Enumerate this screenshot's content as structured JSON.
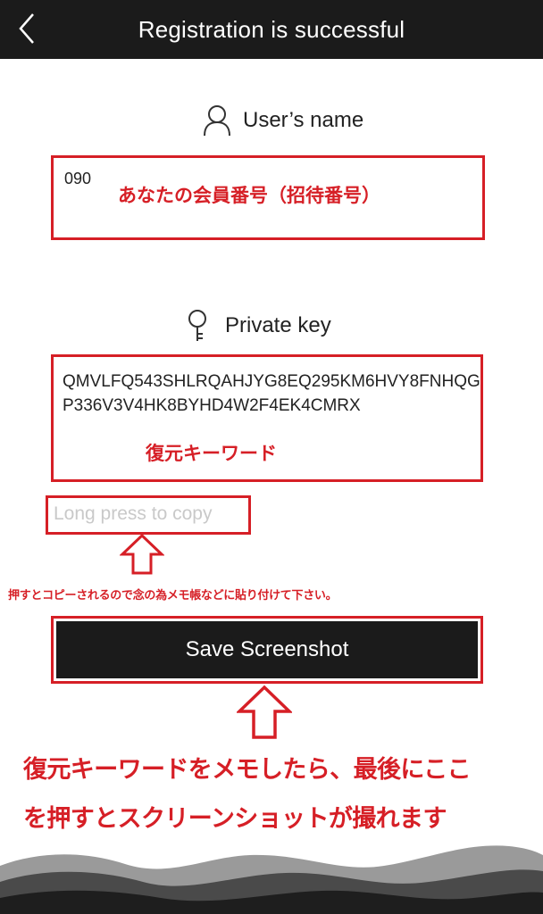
{
  "header": {
    "title": "Registration is successful",
    "back_icon": "chevron-left-icon"
  },
  "user_field": {
    "icon": "user-icon",
    "label": "User’s name",
    "value": "090",
    "annotation": "あなたの会員番号（招待番号）"
  },
  "key_field": {
    "icon": "key-icon",
    "label": "Private key",
    "value": "QMVLFQ543SHLRQAHJYG8EQ295KM6HVY8FNHQGP336V3V4HK8BYHD4W2F4EK4CMRX",
    "annotation": "復元キーワード"
  },
  "copy_hint": {
    "text": "Long press to copy",
    "note": "押すとコピーされるので念の為メモ帳などに貼り付けて下さい。"
  },
  "save_button": {
    "label": "Save Screenshot"
  },
  "instructions": {
    "line1": "復元キーワードをメモしたら、最後にここ",
    "line2": "を押すとスクリーンショットが撮れます"
  },
  "colors": {
    "header_bg": "#1b1b1b",
    "annotation_red": "#d61f26",
    "button_bg": "#1b1b1b",
    "hint_gray": "#c9c9c9"
  }
}
